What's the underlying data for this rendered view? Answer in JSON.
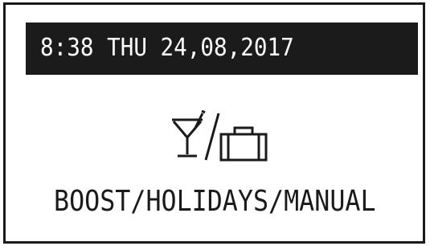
{
  "status_bar": {
    "datetime": "8:38 THU 24,08,2017"
  },
  "mode": {
    "icon": "cocktail-glass-slash-suitcase-icon",
    "label": "BOOST/HOLIDAYS/MANUAL"
  },
  "colors": {
    "background": "#ffffff",
    "foreground": "#1a1a1a",
    "status_bar_bg": "#1b1b1b",
    "status_bar_text": "#ffffff"
  }
}
